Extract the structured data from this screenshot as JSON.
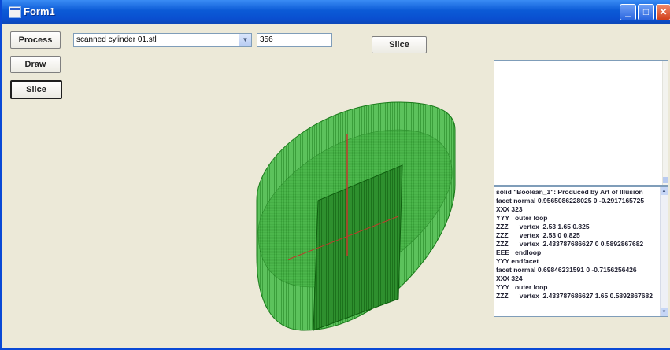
{
  "window": {
    "title": "Form1"
  },
  "controls": {
    "process_label": "Process",
    "draw_label": "Draw",
    "slice_left_label": "Slice",
    "slice_top_label": "Slice",
    "file_combo_value": "scanned cylinder 01.stl",
    "number_value": "356"
  },
  "colors": {
    "mesh_green": "#1a8a1a",
    "mesh_fill": "#4fbf4f",
    "axis_red": "#c0392b",
    "titlebar_blue": "#0b5ad6"
  },
  "stl_text": {
    "lines": [
      "solid \"Boolean_1\": Produced by Art of Illusion",
      "facet normal 0.9565086228025 0 -0.2917165725",
      "XXX 323",
      "YYY   outer loop",
      "ZZZ      vertex  2.53 1.65 0.825",
      "ZZZ      vertex  2.53 0 0.825",
      "ZZZ      vertex  2.433787686627 0 0.5892867682",
      "EEE   endloop",
      "YYY endfacet",
      "facet normal 0.69846231591 0 -0.7156256426",
      "XXX 324",
      "YYY   outer loop",
      "ZZZ      vertex  2.433787686627 1.65 0.5892867682"
    ]
  }
}
